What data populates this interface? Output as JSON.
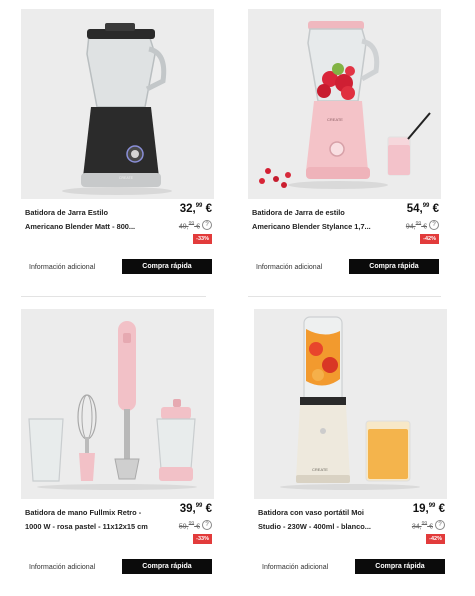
{
  "products": [
    {
      "name_lines": [
        "Batidora de Jarra Estilo",
        "Americano Blender Matt - 800..."
      ],
      "price_int": "32,",
      "price_dec": "99",
      "price_cur": " €",
      "old_int": "49,",
      "old_dec": "99",
      "old_cur": " €",
      "discount": "-33%",
      "info_label": "Información adicional",
      "buy_label": "Compra rápida",
      "image_icon": "black-countertop-blender"
    },
    {
      "name_lines": [
        "Batidora de Jarra de estilo",
        "Americano Blender Stylance 1,7..."
      ],
      "price_int": "54,",
      "price_dec": "99",
      "price_cur": " €",
      "old_int": "94,",
      "old_dec": "99",
      "old_cur": " €",
      "discount": "-42%",
      "info_label": "Información adicional",
      "buy_label": "Compra rápida",
      "image_icon": "pink-countertop-blender"
    },
    {
      "name_lines": [
        "Batidora de mano Fullmix Retro -",
        "1000 W - rosa pastel - 11x12x15 cm"
      ],
      "price_int": "39,",
      "price_dec": "99",
      "price_cur": " €",
      "old_int": "59,",
      "old_dec": "99",
      "old_cur": " €",
      "discount": "-33%",
      "info_label": "Información adicional",
      "buy_label": "Compra rápida",
      "image_icon": "pink-hand-blender-set"
    },
    {
      "name_lines": [
        "Batidora con vaso portátil Moi",
        "Studio - 230W - 400ml - blanco..."
      ],
      "price_int": "19,",
      "price_dec": "99",
      "price_cur": " €",
      "old_int": "34,",
      "old_dec": "99",
      "old_cur": " €",
      "discount": "-42%",
      "info_label": "Información adicional",
      "buy_label": "Compra rápida",
      "image_icon": "cream-personal-blender"
    }
  ],
  "brand_mark": "CREATE"
}
